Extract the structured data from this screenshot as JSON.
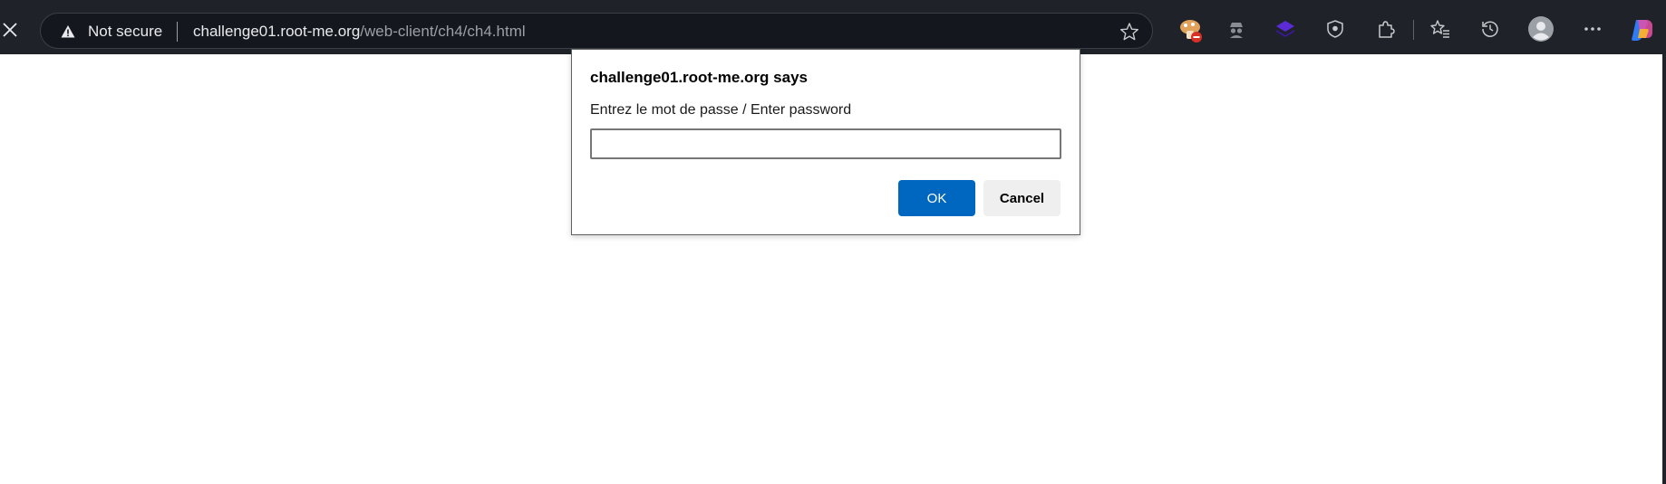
{
  "address_bar": {
    "security_label": "Not secure",
    "url_host": "challenge01.root-me.org",
    "url_path": "/web-client/ch4/ch4.html"
  },
  "toolbar_icons": [
    "favorite-star-icon",
    "extension-mushroom-icon",
    "extension-spy-icon",
    "extension-stack-icon",
    "shield-extension-icon",
    "extensions-puzzle-icon",
    "favorites-icon",
    "history-icon",
    "profile-avatar-icon",
    "more-menu-icon",
    "copilot-icon"
  ],
  "dialog": {
    "title": "challenge01.root-me.org says",
    "message": "Entrez le mot de passe / Enter password",
    "input_value": "",
    "ok_label": "OK",
    "cancel_label": "Cancel"
  },
  "colors": {
    "toolbar_bg": "#1f2229",
    "omnibox_bg": "#14171d",
    "ok_button": "#0067c0",
    "cancel_button": "#efefef"
  }
}
